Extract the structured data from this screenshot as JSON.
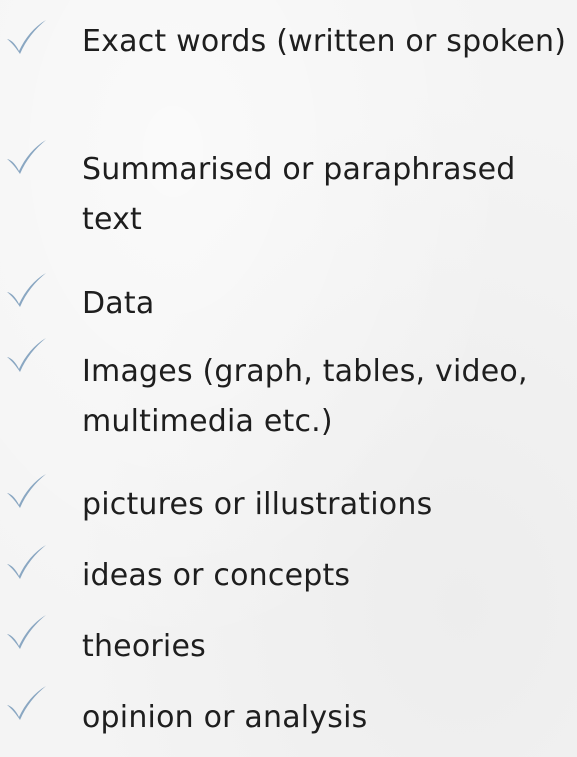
{
  "accent_color": "#8aa7c2",
  "bullet_icon": "checkmark-icon",
  "items": [
    {
      "text": "Exact words (written or spoken)"
    },
    {
      "text": "Summarised or paraphrased text"
    },
    {
      "text": "Data"
    },
    {
      "text": "Images (graph, tables, video, multimedia etc.)"
    },
    {
      "text": "pictures or illustrations"
    },
    {
      "text": "ideas or concepts"
    },
    {
      "text": "theories"
    },
    {
      "text": "opinion or analysis"
    }
  ]
}
